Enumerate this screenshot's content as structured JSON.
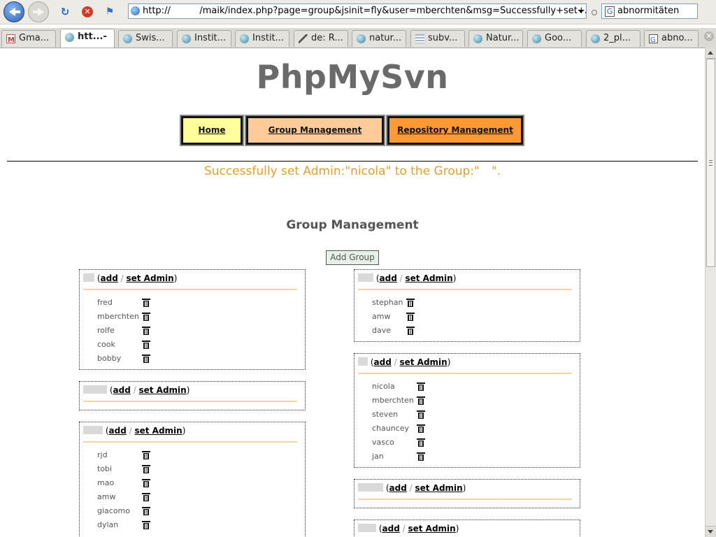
{
  "browser": {
    "url": "http://                /maik/index.php?page=group&jsinit=fly&user=mberchten&msg=Successfully+set+A",
    "search_value": "abnormitäten",
    "tabs": [
      {
        "label": "Gma...",
        "icon": "gmail-icon"
      },
      {
        "label": "htt...-",
        "icon": "globe-icon"
      },
      {
        "label": "Swis...",
        "icon": "globe-icon"
      },
      {
        "label": "Instit...",
        "icon": "globe-icon"
      },
      {
        "label": "Instit...",
        "icon": "globe-icon"
      },
      {
        "label": "de: R...",
        "icon": "pencil-icon"
      },
      {
        "label": "natur...",
        "icon": "globe-icon"
      },
      {
        "label": "subv...",
        "icon": "document-icon"
      },
      {
        "label": "Natur...",
        "icon": "globe-icon"
      },
      {
        "label": "Goo...",
        "icon": "globe-icon"
      },
      {
        "label": "2_pl...",
        "icon": "globe-icon"
      },
      {
        "label": "abno...",
        "icon": "google-icon"
      }
    ],
    "active_tab": 1
  },
  "site": {
    "title": "PhpMySvn",
    "nav": {
      "home": "Home",
      "group": "Group Management",
      "repo": "Repository Management"
    },
    "colors": {
      "home": "#ffff9c",
      "group": "#ffcc99",
      "repo": "#ff9933",
      "message": "#e0a030"
    }
  },
  "status_message": "Successfully set Admin:\"nicola\" to the Group:\" \".",
  "section_title": "Group Management",
  "add_group_label": "Add Group",
  "group_labels": {
    "add": "add",
    "set_admin": "set Admin",
    "sep": "/"
  },
  "groups_left": [
    {
      "members": [
        "fred",
        "mberchten",
        "rolfe",
        "cook",
        "bobby"
      ]
    },
    {
      "members": []
    },
    {
      "members": [
        "rjd",
        "tobi",
        "mao",
        "amw",
        "giacomo",
        "dylan"
      ]
    }
  ],
  "groups_right": [
    {
      "members": [
        "stephan",
        "amw",
        "dave"
      ]
    },
    {
      "members": [
        "nicola",
        "mberchten",
        "steven",
        "chauncey",
        "vasco",
        "jan"
      ]
    },
    {
      "members": []
    },
    {
      "members": []
    }
  ]
}
